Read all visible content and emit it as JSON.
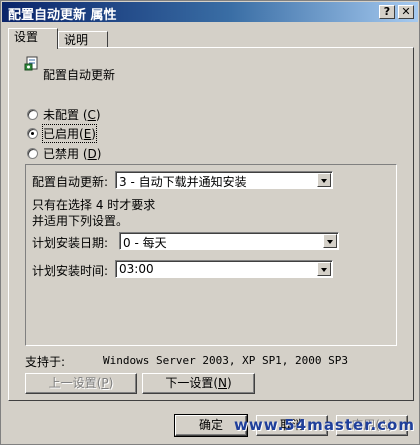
{
  "window": {
    "title": "配置自动更新 属性",
    "help_button": "?",
    "close_button": "✕"
  },
  "tabs": [
    {
      "label": "设置"
    },
    {
      "label": "说明"
    }
  ],
  "policy": {
    "icon": "policy-settings-icon",
    "name": "配置自动更新"
  },
  "radios": [
    {
      "label": "未配置",
      "key": "C",
      "checked": false
    },
    {
      "label": "已启用",
      "key": "E",
      "checked": true
    },
    {
      "label": "已禁用",
      "key": "D",
      "checked": false
    }
  ],
  "options": {
    "configure_label": "配置自动更新:",
    "configure_value": "3 - 自动下载并通知安装",
    "note_line1": "只有在选择 4 时才要求",
    "note_line2": "并适用下列设置。",
    "day_label": "计划安装日期:",
    "day_value": "0 - 每天",
    "time_label": "计划安装时间:",
    "time_value": "03:00"
  },
  "supported": {
    "label": "支持于:",
    "value": "Windows Server 2003, XP SP1, 2000 SP3"
  },
  "nav": {
    "prev_label": "上一设置",
    "prev_key": "P",
    "next_label": "下一设置",
    "next_key": "N"
  },
  "footer": {
    "ok": "确定",
    "cancel": "取消",
    "apply": "应用(A)"
  },
  "watermark": "www.54master.com"
}
